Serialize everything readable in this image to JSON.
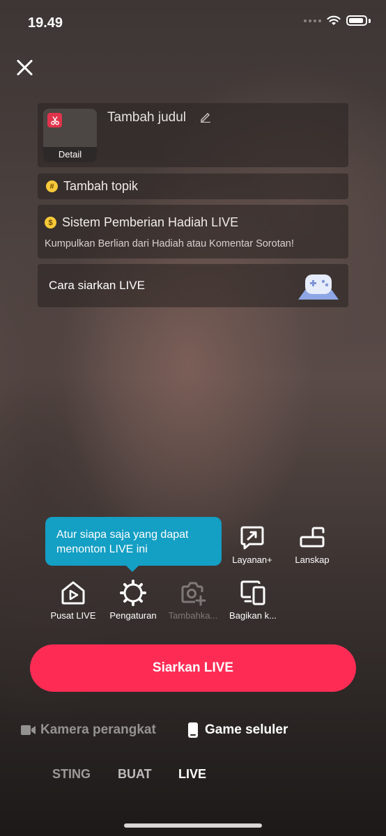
{
  "status": {
    "time": "19.49"
  },
  "setup": {
    "thumb_label": "Detail",
    "title_placeholder": "Tambah judul",
    "topic_label": "Tambah topik",
    "gift_title": "Sistem Pemberian Hadiah LIVE",
    "gift_subtitle": "Kumpulkan Berlian dari Hadiah atau Komentar Sorotan!",
    "howto_label": "Cara siarkan LIVE"
  },
  "tooltip": {
    "text": "Atur siapa saja yang dapat menonton LIVE ini"
  },
  "tools": {
    "layanan": "Layanan+",
    "lanskap": "Lanskap",
    "pusat": "Pusat LIVE",
    "pengaturan": "Pengaturan",
    "tambahkan": "Tambahka...",
    "bagikan": "Bagikan k..."
  },
  "go_live": {
    "label": "Siarkan LIVE"
  },
  "modes": {
    "camera": "Kamera perangkat",
    "game": "Game seluler"
  },
  "tabs": {
    "posting": "STING",
    "buat": "BUAT",
    "live": "LIVE"
  },
  "colors": {
    "primary": "#fe2c55",
    "tooltip": "#149fc4",
    "thumb_badge": "#e0344c"
  },
  "icons": [
    "close-icon",
    "scissors-icon",
    "pencil-icon",
    "hashtag-icon",
    "money-bag-icon",
    "game-controller-icon",
    "chat-arrow-icon",
    "landscape-icon",
    "live-center-icon",
    "gear-icon",
    "camera-plus-icon",
    "share-screen-icon",
    "video-camera-icon",
    "phone-icon"
  ]
}
